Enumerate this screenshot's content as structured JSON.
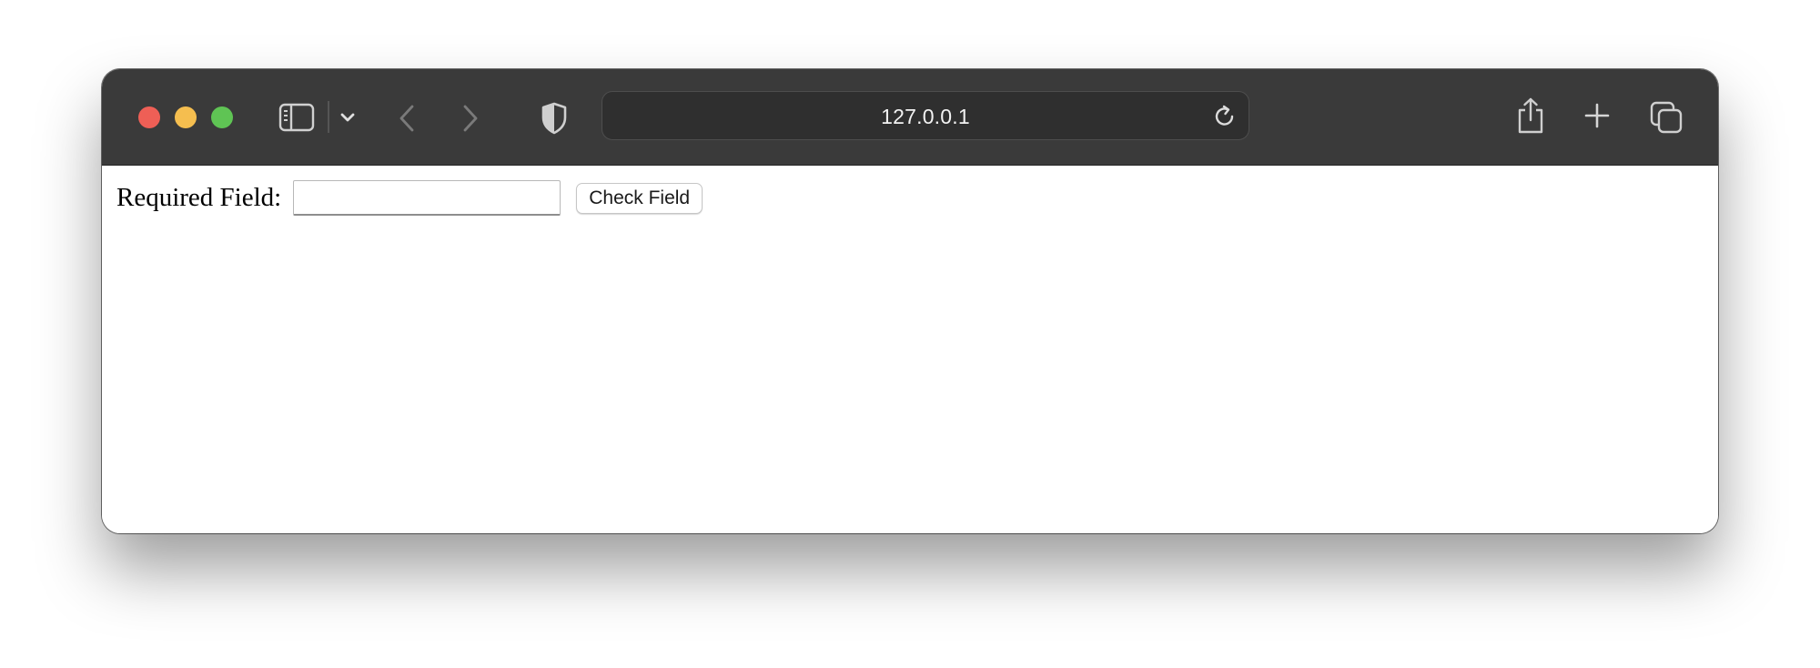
{
  "browser": {
    "url": "127.0.0.1",
    "icons": {
      "sidebar": "sidebar-icon",
      "chevron": "chevron-down-icon",
      "back": "back-arrow-icon",
      "forward": "forward-arrow-icon",
      "privacy": "shield-icon",
      "reload": "reload-icon",
      "share": "share-icon",
      "new_tab": "plus-icon",
      "tab_overview": "tabs-icon"
    },
    "colors": {
      "toolbar": "#3a3a3a",
      "close": "#ee5f56",
      "minimize": "#f5be4f",
      "zoom": "#5fc454"
    }
  },
  "page": {
    "label": "Required Field:",
    "input_value": "",
    "button_label": "Check Field"
  }
}
